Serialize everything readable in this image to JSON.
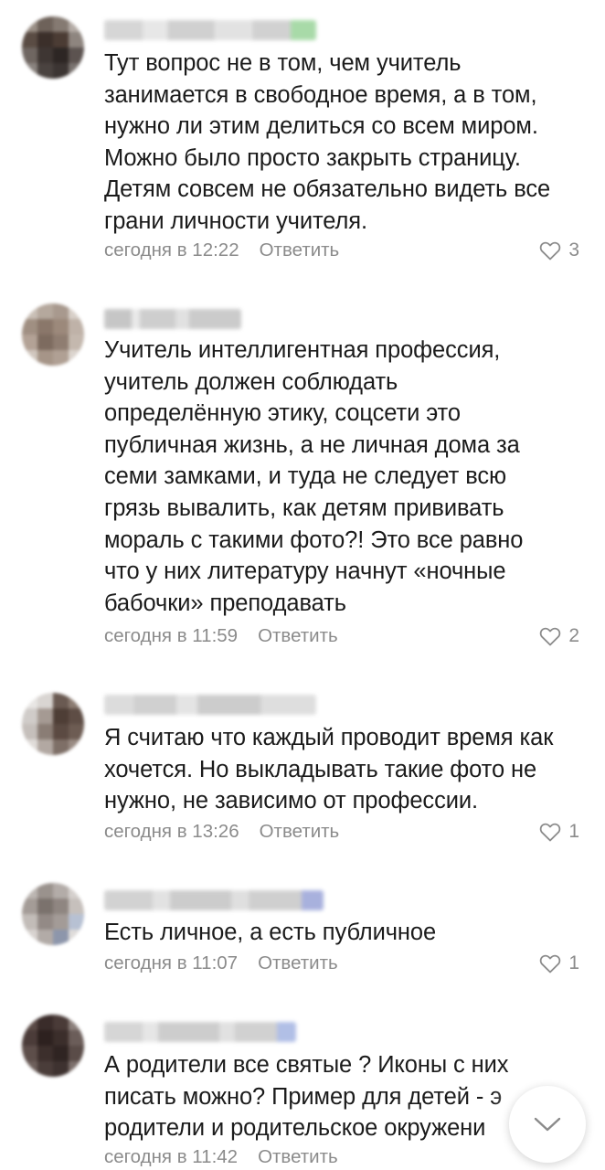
{
  "comments": [
    {
      "lines": [
        "Тут вопрос не в том, чем учитель",
        "занимается в свободное время, а в том,",
        "нужно ли этим делиться со всем миром.",
        "Можно было просто закрыть страницу.",
        "Детям совсем не обязательно видеть все",
        "грани личности учителя."
      ],
      "time": "сегодня в 12:22",
      "reply": "Ответить",
      "likes": "3"
    },
    {
      "lines": [
        "Учитель интеллигентная профессия,",
        "учитель должен соблюдать",
        "определённую этику, соцсети это",
        "публичная жизнь, а не личная дома за",
        "семи замками, и туда не следует всю",
        "грязь вывалить, как детям прививать",
        "мораль с такими фото?! Это все равно",
        "что у них литературу начнут «ночные",
        "бабочки» преподавать"
      ],
      "time": "сегодня в 11:59",
      "reply": "Ответить",
      "likes": "2"
    },
    {
      "lines": [
        "Я считаю что каждый проводит время как",
        "хочется. Но выкладывать такие фото не",
        "нужно, не зависимо от профессии."
      ],
      "time": "сегодня в 13:26",
      "reply": "Ответить",
      "likes": "1"
    },
    {
      "lines": [
        "Есть личное, а есть публичное"
      ],
      "time": "сегодня в 11:07",
      "reply": "Ответить",
      "likes": "1"
    },
    {
      "lines": [
        "А родители все святые ? Иконы с них",
        "писать можно? Пример для детей - э",
        "родители и родительское окружени"
      ],
      "time": "сегодня в 11:42",
      "reply": "Ответить",
      "likes": ""
    }
  ],
  "icons": {
    "like": "heart-icon",
    "scroll": "chevron-down-icon"
  },
  "colors": {
    "meta_text": "#8b8b8b",
    "body_text": "#1b1b1b",
    "background": "#ffffff"
  }
}
